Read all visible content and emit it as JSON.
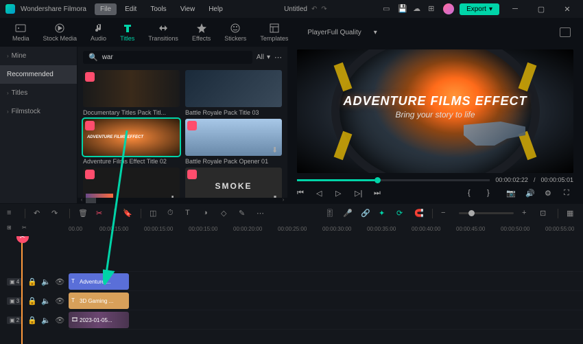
{
  "titlebar": {
    "app": "Wondershare Filmora",
    "menus": [
      "File",
      "Edit",
      "Tools",
      "View",
      "Help"
    ],
    "project": "Untitled",
    "export": "Export"
  },
  "tabs": {
    "items": [
      {
        "label": "Media",
        "icon": "media"
      },
      {
        "label": "Stock Media",
        "icon": "stock"
      },
      {
        "label": "Audio",
        "icon": "audio"
      },
      {
        "label": "Titles",
        "icon": "titles"
      },
      {
        "label": "Transitions",
        "icon": "transitions"
      },
      {
        "label": "Effects",
        "icon": "effects"
      },
      {
        "label": "Stickers",
        "icon": "stickers"
      },
      {
        "label": "Templates",
        "icon": "templates"
      }
    ],
    "active_index": 3,
    "player_label": "Player",
    "quality": "Full Quality"
  },
  "sidebar": {
    "items": [
      {
        "label": "Mine"
      },
      {
        "label": "Recommended"
      },
      {
        "label": "Titles"
      },
      {
        "label": "Filmstock"
      }
    ],
    "active_index": 1
  },
  "search": {
    "query": "war",
    "filter": "All"
  },
  "thumbs": [
    {
      "label": "Documentary Titles Pack Titl..."
    },
    {
      "label": "Battle Royale Pack Title 03"
    },
    {
      "label": "Adventure Films Effect Title 02",
      "selected": true
    },
    {
      "label": "Battle Royale Pack Opener 01"
    },
    {
      "label": ""
    },
    {
      "label": ""
    }
  ],
  "smoke_text": "SMOKE",
  "preview": {
    "title": "ADVENTURE FILMS EFFECT",
    "subtitle": "Bring your story to life",
    "current_time": "00:00:02:22",
    "duration": "00:00:05:01"
  },
  "ruler": {
    "ticks": [
      "00.00",
      "00:00:15:00",
      "00:00:15:00",
      "00:00:15:00",
      "00:00:20:00",
      "00:00:25:00",
      "00:00:30:00",
      "00:00:35:00",
      "00:00:40:00",
      "00:00:45:00",
      "00:00:50:00",
      "00:00:55:00"
    ]
  },
  "tracks": {
    "rows": [
      {
        "num": "4",
        "clip": "Adventure ...",
        "type": "title"
      },
      {
        "num": "3",
        "clip": "3D Gaming ...",
        "type": "title2"
      },
      {
        "num": "2",
        "clip": "2023-01-05...",
        "type": "video"
      }
    ]
  },
  "colors": {
    "accent": "#00d4a8",
    "danger": "#ff4d6d",
    "playhead": "#ff9a3c"
  }
}
